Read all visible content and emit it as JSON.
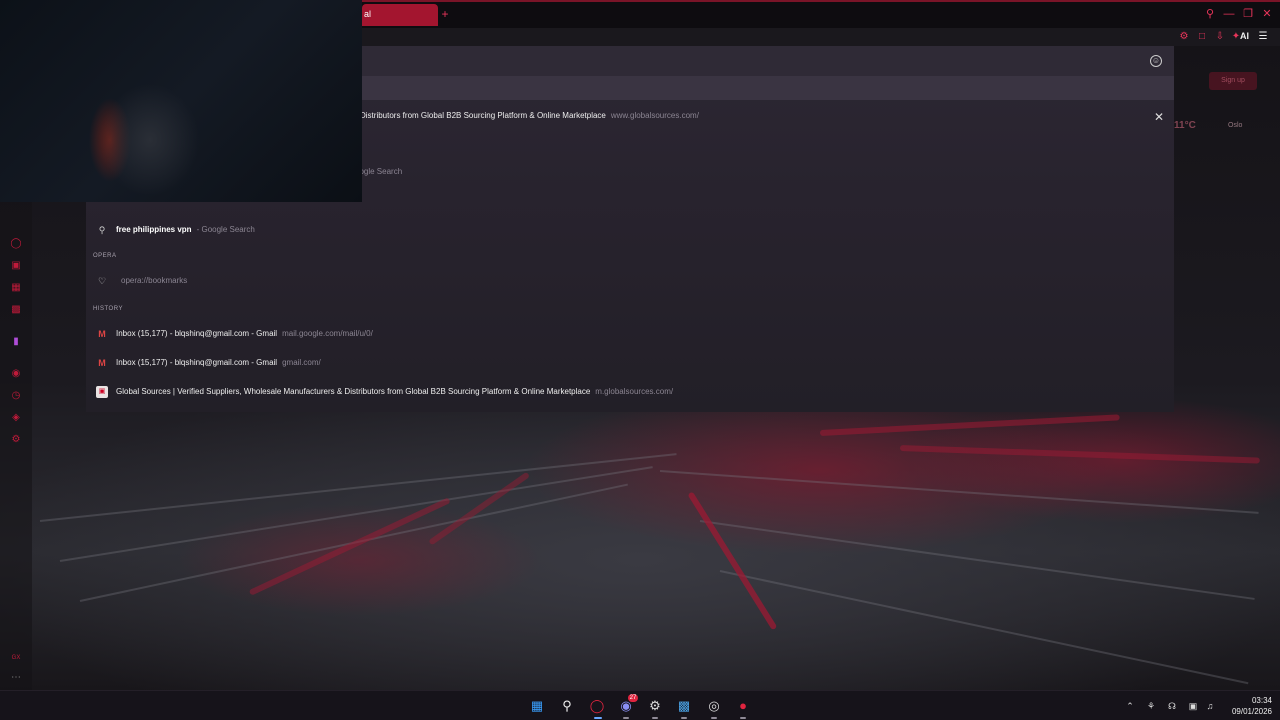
{
  "browser": {
    "active_tab_title": "al",
    "ai_label": "AI",
    "accent_color": "#a3152f"
  },
  "dropdown": {
    "top_result": {
      "title": "Distributors from Global B2B Sourcing Platform & Online Marketplace",
      "url": "www.globalsources.com/"
    },
    "partial_search_suffix": "oogle Search",
    "search_suggestions": [
      {
        "query": "free philippines vpn",
        "source": "- Google Search",
        "icon": "search-icon"
      }
    ],
    "opera_header": "OPERA",
    "opera_items": [
      {
        "text": "opera://bookmarks",
        "icon": "heart-icon"
      }
    ],
    "history_header": "HISTORY",
    "history_items": [
      {
        "title": "Inbox (15,177) - blqshinq@gmail.com - Gmail",
        "url": "mail.google.com/mail/u/0/",
        "icon": "gmail-icon"
      },
      {
        "title": "Inbox (15,177) - blqshinq@gmail.com - Gmail",
        "url": "gmail.com/",
        "icon": "gmail-icon"
      },
      {
        "title": "Global Sources | Verified Suppliers, Wholesale Manufacturers & Distributors from Global B2B Sourcing Platform & Online Marketplace",
        "url": "m.globalsources.com/",
        "icon": "globalsources-icon"
      }
    ]
  },
  "background_widgets": {
    "sign_up": "Sign up",
    "temperature": "11°C",
    "city": "Oslo"
  },
  "taskbar": {
    "time": "03:34",
    "date": "09/01/2026",
    "discord_badge": "27"
  }
}
